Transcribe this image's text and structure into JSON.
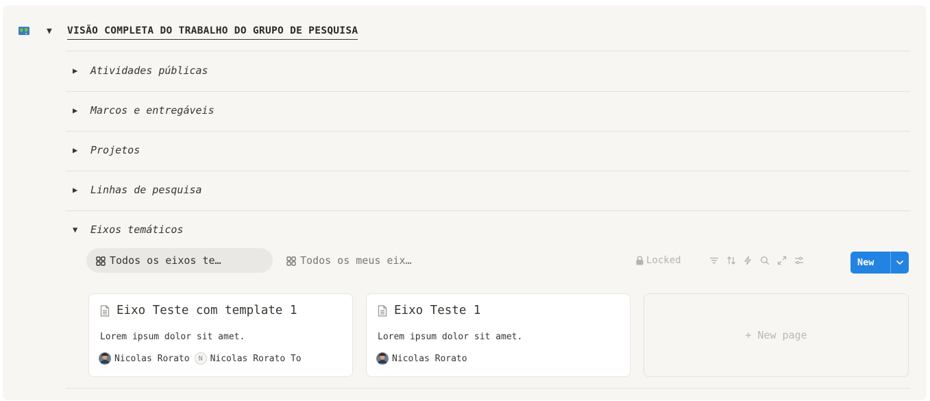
{
  "header": {
    "icon": "world-map-icon",
    "title": "VISÃO COMPLETA DO TRABALHO DO GRUPO DE PESQUISA"
  },
  "sections": [
    {
      "label": "Atividades públicas",
      "expanded": false
    },
    {
      "label": "Marcos e entregáveis",
      "expanded": false
    },
    {
      "label": "Projetos",
      "expanded": false
    },
    {
      "label": "Linhas de pesquisa",
      "expanded": false
    },
    {
      "label": "Eixos temáticos",
      "expanded": true
    }
  ],
  "views": {
    "tabs": [
      {
        "label": "Todos os eixos te…",
        "icon": "gallery-grid-icon",
        "active": true
      },
      {
        "label": "Todos os meus eix…",
        "icon": "gallery-grid-icon",
        "active": false
      }
    ]
  },
  "toolbar": {
    "locked_label": "Locked",
    "icons": [
      "filter-icon",
      "sort-icon",
      "automation-icon",
      "search-icon",
      "expand-icon",
      "settings-icon"
    ],
    "new_label": "New",
    "accent": "#2383e2"
  },
  "cards": [
    {
      "title": "Eixo Teste com template 1",
      "description": "Lorem ipsum dolor sit amet.",
      "person_1": "Nicolas Rorato",
      "initial": "N",
      "person_2": "Nicolas Rorato To"
    },
    {
      "title": "Eixo Teste 1",
      "description": "Lorem ipsum dolor sit amet.",
      "person_1": "Nicolas Rorato"
    }
  ],
  "new_page_label": "+ New page"
}
